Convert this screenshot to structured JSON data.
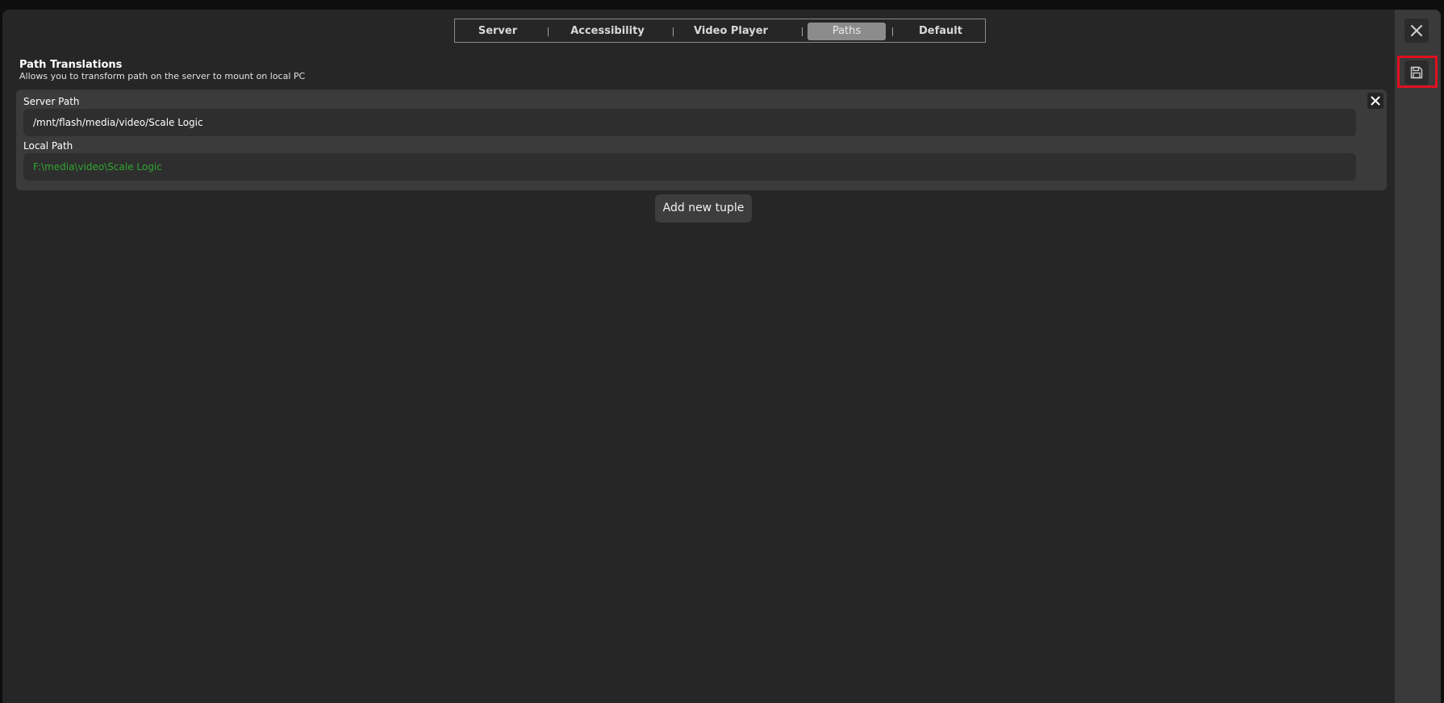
{
  "tabs": [
    {
      "label": "Server"
    },
    {
      "label": "Accessibility"
    },
    {
      "label": "Video Player"
    },
    {
      "label": "Paths"
    },
    {
      "label": "Default"
    }
  ],
  "active_tab": "Paths",
  "section": {
    "title": "Path Translations",
    "description": "Allows you to transform path on the server to mount on local PC"
  },
  "tuple": {
    "server_path_label": "Server Path",
    "server_path_value": "/mnt/flash/media/video/Scale Logic",
    "local_path_label": "Local Path",
    "local_path_value": "F:\\media\\video\\Scale Logic"
  },
  "add_button_label": "Add new tuple",
  "icons": {
    "tuple_remove": "close-icon",
    "window_close": "close-icon",
    "save": "floppy-disk-icon"
  },
  "colors": {
    "background": "#262626",
    "sidebar": "#3a3a3a",
    "card": "#3b3b3b",
    "local_path_text": "#2fa52f",
    "highlight": "#e0101e",
    "active_tab": "#8c8c8c"
  }
}
